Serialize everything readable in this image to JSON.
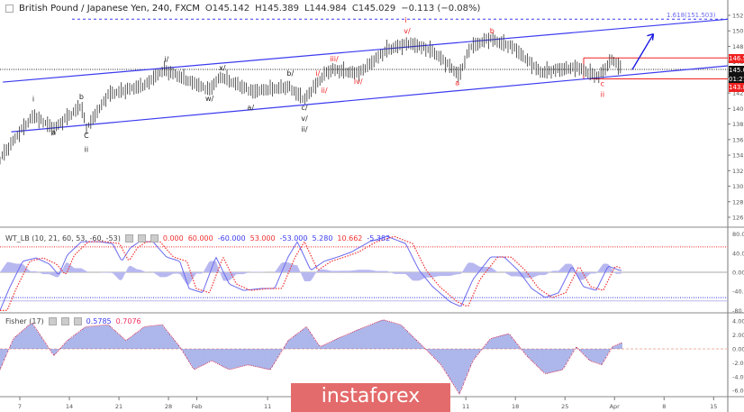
{
  "header": {
    "symbol": "British Pound / Japanese Yen, 240, FXCM",
    "open": "O145.142",
    "high": "H145.389",
    "low": "L144.984",
    "close": "C145.029",
    "change": "−0.113 (−0.08%)"
  },
  "price_axis": {
    "labels": [
      "152.000",
      "150.000",
      "148.000",
      "146.000",
      "144.000",
      "142.000",
      "140.000",
      "138.000",
      "136.000",
      "134.000",
      "132.000",
      "130.000",
      "128.000",
      "126.000"
    ],
    "tags": {
      "upper": "146.511",
      "last": "145.029",
      "countdown": "01:21:29",
      "lower": "143.817"
    }
  },
  "fib_label": "1.618(151.503)",
  "wt": {
    "title": "WT_LB (10, 21, 60, 53, -60, -53)",
    "values": [
      "0.000",
      "60.000",
      "-60.000",
      "53.000",
      "-53.000",
      "5.280",
      "10.662",
      "-5.382"
    ],
    "axis": [
      "80.000",
      "40.000",
      "0.000",
      "-40.000",
      "-80.000"
    ]
  },
  "fisher": {
    "title": "Fisher (17)",
    "values": [
      "0.5785",
      "0.7076"
    ],
    "axis": [
      "4.0000",
      "2.0000",
      "0.0000",
      "-2.0000",
      "-4.0000",
      "-6.0000"
    ]
  },
  "time_axis": [
    "7",
    "14",
    "21",
    "28",
    "Feb",
    "11",
    "11",
    "18",
    "25",
    "Apr",
    "8",
    "15"
  ],
  "logo": "instaforex",
  "colors": {
    "channel": "#3b3bf0",
    "red": "#f02020",
    "wt": "#6a6af0",
    "signal": "#f03030",
    "area": "#b8b8f0"
  },
  "chart_data": {
    "type": "line",
    "title": "British Pound / Japanese Yen, 240, FXCM",
    "x_unit": "days since Jan 7",
    "price": {
      "x": [
        -2.8,
        -0.3,
        1.9,
        4.8,
        8.7,
        9.4,
        12.5,
        17.6,
        20.4,
        26.7,
        28.4,
        32.8,
        37.9,
        40.2,
        43.3,
        44.5,
        47.8,
        51.9,
        55.1,
        58.3,
        62.1,
        63.6,
        66.3,
        69.7,
        73.5,
        78.6,
        81.8,
        83.7,
        85
      ],
      "y": [
        133.5,
        136.6,
        139.1,
        137.4,
        140.4,
        137.4,
        141.8,
        143,
        145,
        142.4,
        144.1,
        142.2,
        142.8,
        141.2,
        144.7,
        145,
        144.5,
        147.6,
        148.4,
        147.4,
        144.3,
        147.9,
        149,
        147.9,
        144.7,
        145.3,
        144.1,
        146.4,
        145.0
      ]
    },
    "ylim": [
      125,
      152.5
    ],
    "channel_upper": [
      [
        -2.4,
        143.4
      ],
      [
        100,
        151.5
      ]
    ],
    "channel_lower": [
      [
        -1.2,
        137.0
      ],
      [
        100,
        145.5
      ]
    ],
    "levels": {
      "fib": 151.503,
      "last": 145.029,
      "upper": 146.511,
      "lower": 143.817
    },
    "arrow": [
      [
        86.5,
        145.0
      ],
      [
        89.5,
        149.6
      ]
    ],
    "annotations": [
      {
        "t": "i",
        "c": "black",
        "x": 1.9,
        "y": 140.9
      },
      {
        "t": "a",
        "c": "black",
        "x": 4.8,
        "y": 136.6
      },
      {
        "t": "b",
        "c": "black",
        "x": 8.7,
        "y": 141.2
      },
      {
        "t": "C",
        "c": "black",
        "x": 9.4,
        "y": 136.2
      },
      {
        "t": "ii",
        "c": "black",
        "x": 9.4,
        "y": 134.4
      },
      {
        "t": "i/",
        "c": "black",
        "x": 20.7,
        "y": 146.0
      },
      {
        "t": "w/",
        "c": "black",
        "x": 26.8,
        "y": 141.0
      },
      {
        "t": "x/",
        "c": "black",
        "x": 28.6,
        "y": 144.9
      },
      {
        "t": "a/",
        "c": "black",
        "x": 32.6,
        "y": 139.8
      },
      {
        "t": "b/",
        "c": "black",
        "x": 38.2,
        "y": 144.2
      },
      {
        "t": "c/",
        "c": "black",
        "x": 40.2,
        "y": 139.8
      },
      {
        "t": "v/",
        "c": "black",
        "x": 40.2,
        "y": 138.4
      },
      {
        "t": "ii/",
        "c": "black",
        "x": 40.2,
        "y": 137.0
      },
      {
        "t": "i/",
        "c": "red",
        "x": 42.1,
        "y": 144.2
      },
      {
        "t": "ii/",
        "c": "red",
        "x": 43.0,
        "y": 142.0
      },
      {
        "t": "iii/",
        "c": "red",
        "x": 44.4,
        "y": 146.1
      },
      {
        "t": "iv/",
        "c": "red",
        "x": 47.8,
        "y": 143.2
      },
      {
        "t": "i",
        "c": "red",
        "x": 54.5,
        "y": 151.1
      },
      {
        "t": "v/",
        "c": "red",
        "x": 54.7,
        "y": 149.7
      },
      {
        "t": "a",
        "c": "red",
        "x": 61.8,
        "y": 143.0
      },
      {
        "t": "b",
        "c": "red",
        "x": 66.7,
        "y": 149.7
      },
      {
        "t": "c",
        "c": "red",
        "x": 82.3,
        "y": 142.9
      },
      {
        "t": "ii",
        "c": "red",
        "x": 82.3,
        "y": 141.5
      }
    ],
    "wt_series": {
      "x": [
        -2.8,
        -1.5,
        0.4,
        2.3,
        4.2,
        5.5,
        6.7,
        8.7,
        11.2,
        13.1,
        14.4,
        15.6,
        16.9,
        18.8,
        20.7,
        22.6,
        23.9,
        25.8,
        27.7,
        29.6,
        31.6,
        34.1,
        36,
        37.9,
        39.2,
        41.1,
        43,
        44.9,
        46.8,
        49.4,
        51.9,
        54.5,
        56.4,
        58.3,
        60.8,
        62.3,
        64,
        66.5,
        68.4,
        70.4,
        72.3,
        74.2,
        76.1,
        78,
        79.6,
        81.4,
        83.1,
        84.7
      ],
      "y": [
        -80,
        -34,
        23,
        30,
        17,
        -6,
        36,
        64,
        64,
        60,
        23,
        51,
        64,
        64,
        32,
        23,
        -34,
        -43,
        32,
        -25,
        -38,
        -34,
        -34,
        32,
        64,
        4,
        23,
        32,
        42,
        64,
        75,
        60,
        4,
        -30,
        -62,
        -72,
        -15,
        32,
        32,
        4,
        -34,
        -53,
        -43,
        13,
        -30,
        -38,
        13,
        4
      ]
    },
    "wt_levels": [
      53,
      -53
    ],
    "wt_ylim": [
      -80,
      80
    ],
    "fisher_series": {
      "x": [
        -2.8,
        -0.9,
        1.7,
        3.6,
        4.8,
        6.7,
        9.3,
        12.5,
        15,
        17.6,
        20.1,
        22.6,
        24.6,
        27.1,
        29.6,
        32.2,
        35.4,
        37.9,
        40.5,
        42.4,
        44.9,
        48.1,
        51.3,
        53.8,
        57,
        59.5,
        62.1,
        64,
        66.5,
        69.1,
        71.6,
        74.2,
        76.7,
        78.6,
        80.5,
        82.2,
        83.7,
        85
      ],
      "y": [
        -3,
        1.5,
        3.8,
        0.9,
        -1,
        1.2,
        3.2,
        3.5,
        1.2,
        3.2,
        3.5,
        0.3,
        -3,
        -1.7,
        -3,
        -2.3,
        -3,
        1.2,
        3.2,
        0.3,
        1.5,
        2.9,
        4.2,
        3.5,
        0.3,
        -2.3,
        -6.5,
        -1.7,
        1.5,
        2.2,
        -1,
        -3.6,
        -3,
        0.3,
        -1.7,
        -2.3,
        0.3,
        0.9
      ]
    },
    "fisher_ylim": [
      -6,
      4
    ]
  }
}
